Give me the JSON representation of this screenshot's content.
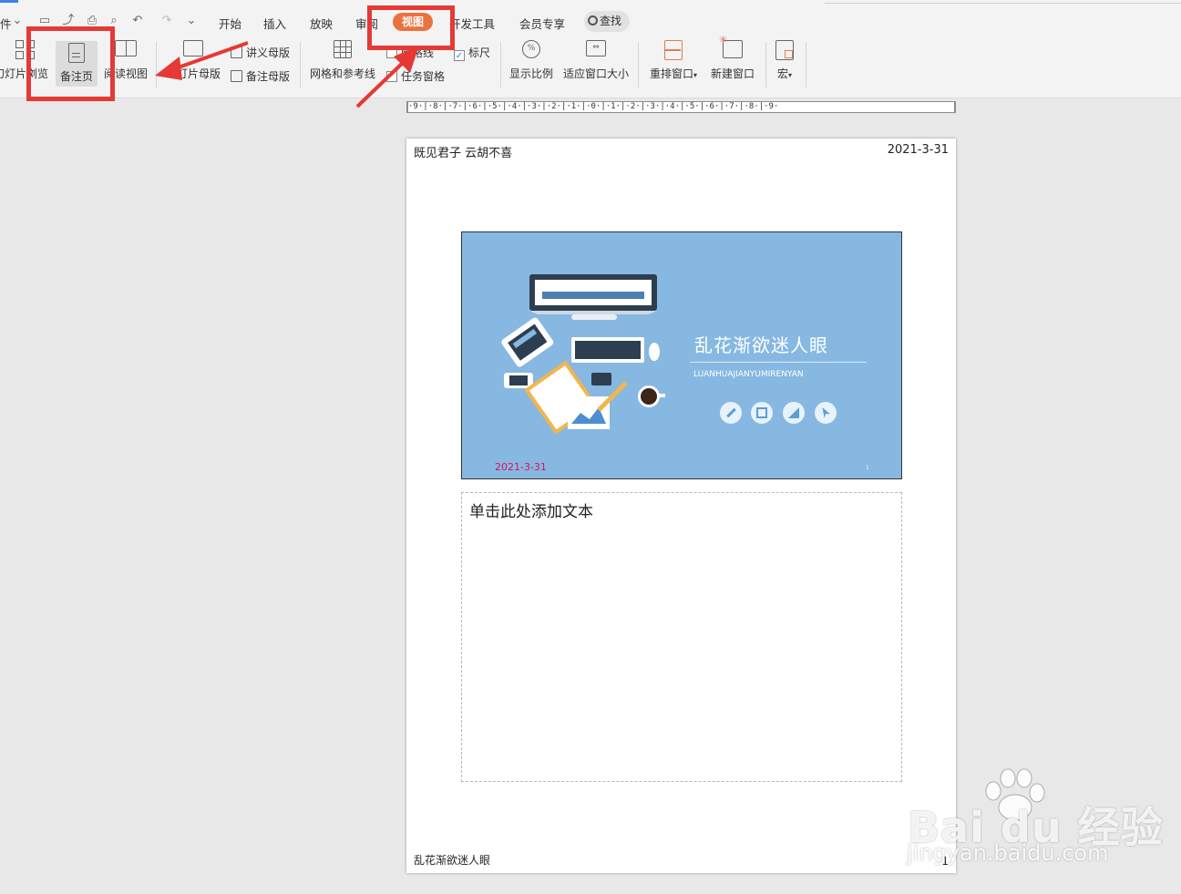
{
  "menu": {
    "file_partial": "件",
    "tabs": [
      "开始",
      "插入",
      "放映",
      "审阅",
      "视图",
      "开发工具",
      "会员专享"
    ],
    "search": "查找"
  },
  "ribbon": {
    "slide_browse": "幻灯片浏览",
    "notes_page": "备注页",
    "reading_view": "阅读视图",
    "slide_master": "幻灯片母版",
    "handout_master": "讲义母版",
    "notes_master": "备注母版",
    "grid_guides": "网格和参考线",
    "gridlines": "网格线",
    "ruler": "标尺",
    "task_pane": "任务窗格",
    "zoom": "显示比例",
    "fit_window": "适应窗口大小",
    "arrange": "重排窗口",
    "new_window": "新建窗口",
    "macro": "宏"
  },
  "ruler_text": "·9·|·8·|·7·|·6·|·5·|·4·|·3·|·2·|·1·|·0·|·1·|·2·|·3·|·4·|·5·|·6·|·7·|·8·|·9·",
  "page": {
    "header_left": "既见君子 云胡不喜",
    "header_right": "2021-3-31",
    "footer_left": "乱花渐欲迷人眼",
    "footer_right": "1",
    "slide": {
      "title": "乱花渐欲迷人眼",
      "subtitle": "LUANHUAJIANYUMIRENYAN",
      "date": "2021-3-31",
      "number": "1"
    },
    "notes_placeholder": "单击此处添加文本"
  },
  "watermark": {
    "logo": "Bai du 经验",
    "url": "jingyan.baidu.com"
  },
  "colors": {
    "accent_tab": "#e9733f",
    "highlight": "#e53935",
    "slide_bg": "#86b8e2"
  }
}
